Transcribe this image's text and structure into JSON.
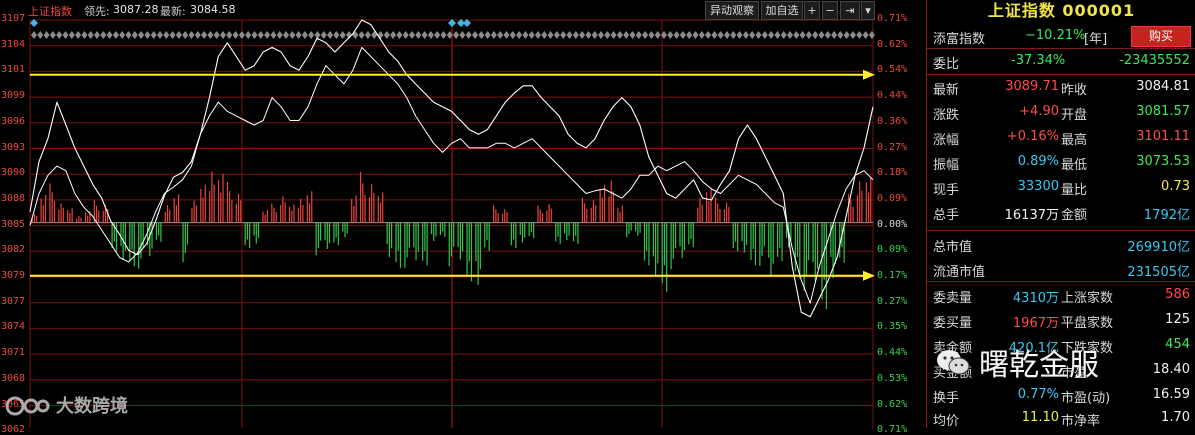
{
  "topbar": {
    "index_name": "上证指数",
    "lead_label": "领先:",
    "lead_value": "3087.28",
    "latest_label": "最新:",
    "latest_value": "3084.58",
    "btn_anomaly": "异动观察",
    "btn_addfav": "加自选",
    "btn_plus": "+",
    "btn_minus": "−",
    "btn_jump": "⇥",
    "btn_menu": "▾"
  },
  "axis": {
    "left": [
      "3107",
      "3104",
      "3101",
      "3099",
      "3096",
      "3093",
      "3090",
      "3088",
      "3085",
      "3082",
      "3079",
      "3077",
      "3074",
      "3071",
      "3068",
      "3065",
      "3062"
    ],
    "right": [
      "0.71%",
      "0.62%",
      "0.54%",
      "0.44%",
      "0.36%",
      "0.27%",
      "0.18%",
      "0.09%",
      "0.00%",
      "0.09%",
      "0.17%",
      "0.27%",
      "0.35%",
      "0.44%",
      "0.53%",
      "0.62%",
      "0.71%"
    ]
  },
  "watermark": {
    "text": "大数跨境",
    "logo": "16c-logo"
  },
  "colors": {
    "up": "#e8453c",
    "down": "#33c44a",
    "grid": "#7a1010",
    "ref_line": "#ffee33",
    "price": "#ffffff"
  },
  "chart_data": {
    "type": "line",
    "title": "上证指数",
    "x_range": [
      0,
      240
    ],
    "ylim": [
      3062,
      3107
    ],
    "prev_close": 3084.81,
    "reference_lines": [
      3101.0,
      3079.0
    ],
    "series": [
      {
        "name": "最新",
        "values": [
          3086.0,
          3091.5,
          3094.0,
          3098.0,
          3095.5,
          3093.0,
          3091.0,
          3089.0,
          3087.5,
          3085.0,
          3083.5,
          3081.8,
          3081.3,
          3082.5,
          3085.0,
          3087.8,
          3089.8,
          3090.3,
          3091.5,
          3094.5,
          3098.5,
          3103.0,
          3104.5,
          3103.0,
          3101.5,
          3102.0,
          3103.5,
          3104.0,
          3103.5,
          3102.0,
          3101.5,
          3103.0,
          3105.0,
          3104.5,
          3103.5,
          3104.5,
          3105.5,
          3107.0,
          3106.5,
          3105.0,
          3103.5,
          3102.5,
          3101.0,
          3100.0,
          3099.0,
          3098.0,
          3097.5,
          3097.0,
          3096.0,
          3095.0,
          3094.5,
          3095.0,
          3096.5,
          3098.0,
          3099.0,
          3099.8,
          3099.8,
          3098.5,
          3097.5,
          3096.5,
          3094.5,
          3093.5,
          3093.0,
          3094.0,
          3096.0,
          3097.5,
          3098.5,
          3097.5,
          3095.5,
          3092.0,
          3090.0,
          3088.0,
          3087.5,
          3088.5,
          3089.5,
          3087.5,
          3087.3,
          3089.0,
          3090.5,
          3094.0,
          3095.5,
          3094.0,
          3092.0,
          3090.0,
          3088.0,
          3080.0,
          3075.0,
          3074.5,
          3076.5,
          3078.5,
          3081.0,
          3085.5,
          3090.0,
          3093.0,
          3097.5
        ]
      },
      {
        "name": "领先",
        "values": [
          3084.5,
          3088.0,
          3090.0,
          3091.0,
          3090.5,
          3088.0,
          3086.5,
          3085.5,
          3084.0,
          3082.5,
          3081.0,
          3080.5,
          3081.5,
          3083.5,
          3086.0,
          3088.0,
          3088.7,
          3089.5,
          3091.0,
          3094.5,
          3096.5,
          3098.0,
          3097.0,
          3096.5,
          3096.0,
          3095.5,
          3096.0,
          3098.5,
          3097.5,
          3096.0,
          3096.0,
          3097.5,
          3100.0,
          3102.0,
          3101.0,
          3100.0,
          3101.5,
          3104.0,
          3103.0,
          3102.0,
          3101.0,
          3100.0,
          3098.5,
          3096.5,
          3095.0,
          3093.5,
          3092.5,
          3093.5,
          3094.0,
          3093.0,
          3093.0,
          3093.0,
          3093.5,
          3093.5,
          3093.0,
          3093.5,
          3094.0,
          3093.0,
          3092.0,
          3091.0,
          3090.0,
          3089.0,
          3088.0,
          3088.3,
          3088.5,
          3088.0,
          3087.5,
          3088.5,
          3090.0,
          3090.0,
          3091.0,
          3090.5,
          3091.0,
          3091.5,
          3090.5,
          3089.3,
          3088.5,
          3088.0,
          3089.0,
          3090.0,
          3089.5,
          3089.0,
          3088.0,
          3087.0,
          3086.5,
          3082.0,
          3078.5,
          3076.0,
          3080.0,
          3083.0,
          3086.0,
          3088.5,
          3090.0,
          3090.5,
          3089.5
        ]
      }
    ],
    "volume_bars": [
      2.1,
      6.5,
      8.2,
      4.0,
      3.0,
      1.6,
      2.7,
      4.6,
      3.7,
      -6.0,
      -8.8,
      -10.2,
      -9.6,
      -7.0,
      -4.0,
      4.1,
      6.6,
      -8.2,
      4.6,
      7.9,
      12.0,
      11.4,
      8.5,
      6.0,
      -5.3,
      -4.9,
      3.0,
      4.0,
      5.5,
      3.8,
      5.6,
      7.4,
      -6.8,
      -5.5,
      -4.7,
      -3.4,
      6.4,
      10.6,
      8.0,
      6.3,
      -8.1,
      -10.6,
      -9.4,
      -7.8,
      -8.9,
      -4.3,
      -3.3,
      -9.1,
      -7.7,
      -12.2,
      -14.6,
      -6.6,
      3.6,
      2.8,
      -5.3,
      -4.7,
      -3.6,
      3.6,
      3.8,
      -4.4,
      -4.1,
      -5.0,
      5.2,
      4.7,
      7.9,
      9.9,
      4.0,
      -3.0,
      -2.7,
      -8.9,
      -12.8,
      -16.2,
      -9.7,
      -7.4,
      -5.1,
      5.7,
      8.2,
      5.2,
      4.2,
      -6.0,
      -7.0,
      -10.0,
      -9.0,
      -11.0,
      -8.0,
      -5.8,
      -13.0,
      -14.2,
      -12.4,
      -18.0,
      -13.0,
      -9.4,
      6.0,
      8.6,
      9.5
    ]
  },
  "quote": {
    "title": "上证指数 000001",
    "rows": [
      {
        "l1": "添富指数",
        "v1": "−10.21%",
        "extra": "[年]",
        "button": "购买"
      },
      {
        "l1": "委比",
        "v1": "-37.34%",
        "v2": "-23435552"
      },
      {
        "l1": "最新",
        "v1": "3089.71",
        "l2": "昨收",
        "v2": "3084.81"
      },
      {
        "l1": "涨跌",
        "v1": "+4.90",
        "l2": "开盘",
        "v2": "3081.57"
      },
      {
        "l1": "涨幅",
        "v1": "+0.16%",
        "l2": "最高",
        "v2": "3101.11"
      },
      {
        "l1": "振幅",
        "v1": "0.89%",
        "l2": "最低",
        "v2": "3073.53"
      },
      {
        "l1": "现手",
        "v1": "33300",
        "l2": "量比",
        "v2": "0.73"
      },
      {
        "l1": "总手",
        "v1": "16137万",
        "l2": "金额",
        "v2": "1792亿"
      },
      {
        "l1": "总市值",
        "v2": "269910亿"
      },
      {
        "l1": "流通市值",
        "v2": "231505亿"
      },
      {
        "l1": "委卖量",
        "v1": "4310万",
        "l2": "上涨家数",
        "v2": "586"
      },
      {
        "l1": "委买量",
        "v1": "1967万",
        "l2": "平盘家数",
        "v2": "125"
      },
      {
        "l1": "卖金额",
        "v1": "420.1亿",
        "l2": "下跌家数",
        "v2": "454"
      },
      {
        "l1": "买金额",
        "v1": "",
        "l2": "市盈",
        "v2": "18.40"
      },
      {
        "l1": "换手",
        "v1": "0.77%",
        "l2": "市盈(动)",
        "v2": "16.59"
      },
      {
        "l1": "均价",
        "v1": "11.10",
        "l2": "市净率",
        "v2": "1.70"
      }
    ],
    "overlay_brand": "曙乾金服",
    "overlay_icon": "wechat-icon"
  }
}
